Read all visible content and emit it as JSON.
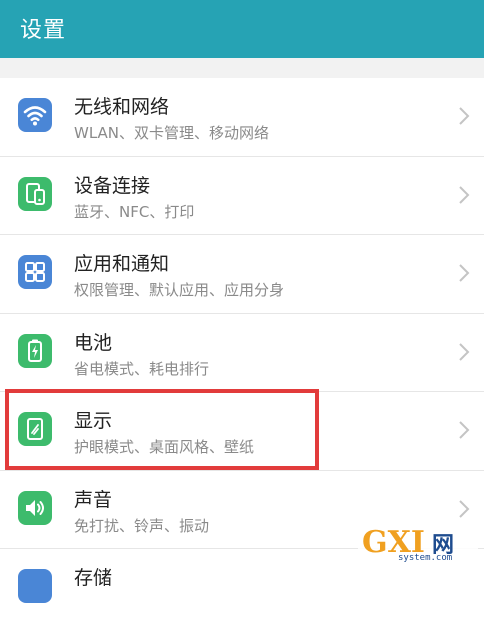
{
  "header": {
    "title": "设置"
  },
  "colors": {
    "header_bg": "#26a3b4",
    "highlight": "#e23b3b",
    "divider": "#e6e6e6"
  },
  "settings": [
    {
      "label": "无线和网络",
      "sub": "WLAN、双卡管理、移动网络",
      "icon": "wifi-icon",
      "icon_color": "#4a86d6"
    },
    {
      "label": "设备连接",
      "sub": "蓝牙、NFC、打印",
      "icon": "device-connection-icon",
      "icon_color": "#3dbb6c"
    },
    {
      "label": "应用和通知",
      "sub": "权限管理、默认应用、应用分身",
      "icon": "apps-icon",
      "icon_color": "#4a86d6"
    },
    {
      "label": "电池",
      "sub": "省电模式、耗电排行",
      "icon": "battery-icon",
      "icon_color": "#3dbb6c"
    },
    {
      "label": "显示",
      "sub": "护眼模式、桌面风格、壁纸",
      "icon": "display-icon",
      "icon_color": "#3dbb6c"
    },
    {
      "label": "声音",
      "sub": "免打扰、铃声、振动",
      "icon": "sound-icon",
      "icon_color": "#3dbb6c"
    },
    {
      "label": "存储",
      "sub": "",
      "icon": "storage-icon",
      "icon_color": "#4a86d6"
    }
  ],
  "watermark": {
    "logo": "GXI",
    "logo_cn": "网",
    "site": "system.com"
  }
}
